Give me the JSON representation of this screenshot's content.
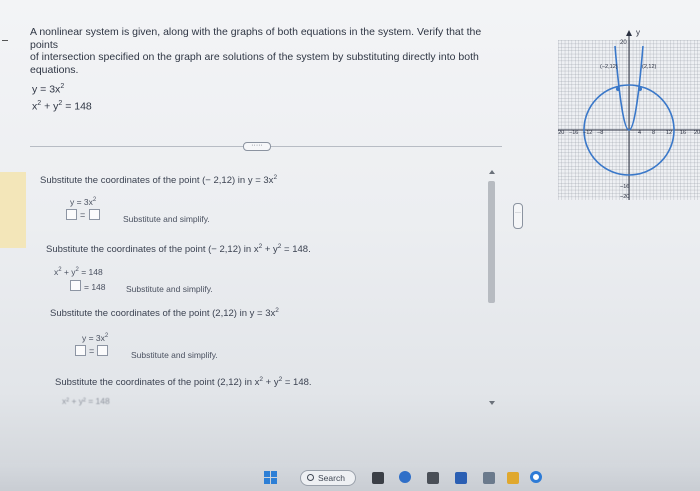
{
  "question": {
    "line1": "A nonlinear system is given, along with the graphs of both equations in the system. Verify that the points",
    "line2": "of intersection specified on the graph are solutions of the system by substituting directly into both",
    "line3": "equations."
  },
  "system": {
    "eq1_lhs": "y = 3x",
    "eq1_exp": "2",
    "eq2_a": "x",
    "eq2_b": " + y",
    "eq2_c": " = 148",
    "exp": "2"
  },
  "expand_button": "·····",
  "steps": [
    {
      "instruction_pre": "Substitute the coordinates of the point (− 2,12) in y = 3x",
      "formula_a": "y = 3x",
      "hint": "Substitute and simplify."
    },
    {
      "instruction_pre": "Substitute the coordinates of the point (− 2,12) in x",
      "instruction_mid": " + y",
      "instruction_post": " = 148.",
      "formula_a": "x",
      "formula_b": " + y",
      "formula_c": " = 148",
      "box_suffix": "= 148",
      "hint": "Substitute and simplify."
    },
    {
      "instruction_pre": "Substitute the coordinates of the point (2,12) in y = 3x",
      "formula_a": "y = 3x",
      "hint": "Substitute and simplify."
    },
    {
      "instruction_pre": "Substitute the coordinates of the point (2,12) in x",
      "instruction_mid": " + y",
      "instruction_post": " = 148.",
      "formula_partial": "x² + y² = 148"
    }
  ],
  "side_toggle": "···",
  "graph": {
    "y_axis_label": "y",
    "y_ticks_top": "20",
    "pt_left": "(−2,12)",
    "pt_right": "(2,12)",
    "x_ticks": [
      "−20",
      "−16",
      "−12",
      "−8",
      "4",
      "8",
      "12",
      "16",
      "20"
    ],
    "y_ticks_bottom": [
      "−16",
      "−20"
    ]
  },
  "taskbar": {
    "search_label": "Search"
  }
}
